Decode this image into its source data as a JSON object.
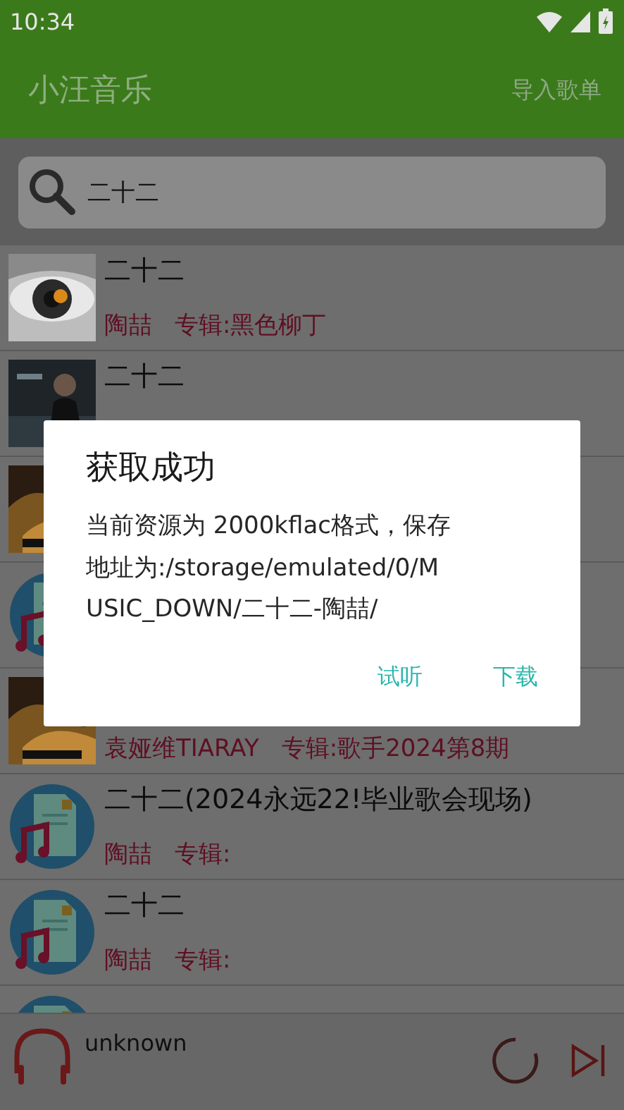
{
  "status_bar": {
    "time": "10:34"
  },
  "app_bar": {
    "title": "小汪音乐",
    "action": "导入歌单"
  },
  "search": {
    "value": "二十二"
  },
  "songs": [
    {
      "kind": "picture",
      "title": "二十二",
      "artist": "陶喆",
      "album": "专辑:黑色柳丁"
    },
    {
      "kind": "picture",
      "title": "二十二"
    },
    {
      "kind": "picture"
    },
    {
      "kind": "music-icon"
    },
    {
      "kind": "picture",
      "artist": "袁娅维TIARAY",
      "album": "专辑:歌手2024第8期"
    },
    {
      "kind": "music-icon",
      "title": "二十二(2024永远22!毕业歌会现场)",
      "artist": "陶喆",
      "album": "专辑:"
    },
    {
      "kind": "music-icon",
      "title": "二十二",
      "artist": "陶喆",
      "album": "专辑:"
    },
    {
      "kind": "music-icon"
    }
  ],
  "dialog": {
    "title": "获取成功",
    "message": "当前资源为 2000kflac格式，保存地址为:/storage/emulated/0/MUSIC_DOWN/二十二-陶喆/",
    "buttons": [
      "试听",
      "下载"
    ]
  },
  "player": {
    "track": "unknown"
  }
}
